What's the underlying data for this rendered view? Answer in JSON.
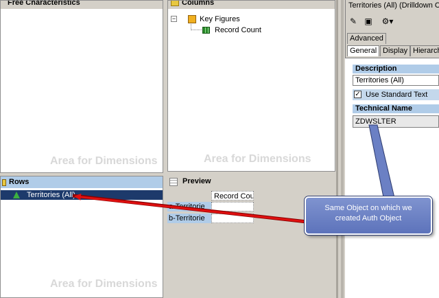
{
  "free_panel": {
    "title": "Free Characteristics",
    "watermark": "Area for Dimensions"
  },
  "columns_panel": {
    "title": "Columns",
    "tree_root": "Key Figures",
    "tree_child": "Record Count",
    "watermark": "Area for Dimensions"
  },
  "rows_panel": {
    "title": "Rows",
    "item": "Territories (All)",
    "watermark": "Area for Dimensions"
  },
  "preview_panel": {
    "title": "Preview",
    "column_header": "Record Cou",
    "rows": [
      "a-Territorie",
      "b-Territorie"
    ]
  },
  "properties": {
    "title": "Territories (All) (Drilldown  CH",
    "tabs": [
      "Advanced",
      "General",
      "Display",
      "Hierarch"
    ],
    "active_tab": "General",
    "description_label": "Description",
    "description_value": "Territories (All)",
    "use_standard_text_label": "Use Standard Text",
    "use_standard_text_checked": true,
    "technical_name_label": "Technical Name",
    "technical_name_value": "ZDWSLTER"
  },
  "callout": {
    "line1": "Same Object on which we",
    "line2": "created Auth Object"
  },
  "colors": {
    "selection": "#1d3a6b",
    "label_band": "#b0cce8",
    "arrow_red": "#e01010",
    "callout": "#6b80c4"
  },
  "icons": [
    "folder-icon",
    "cube-icon",
    "grid-icon",
    "pencil-icon",
    "save-icon",
    "settings-icon",
    "dimension-icon"
  ]
}
